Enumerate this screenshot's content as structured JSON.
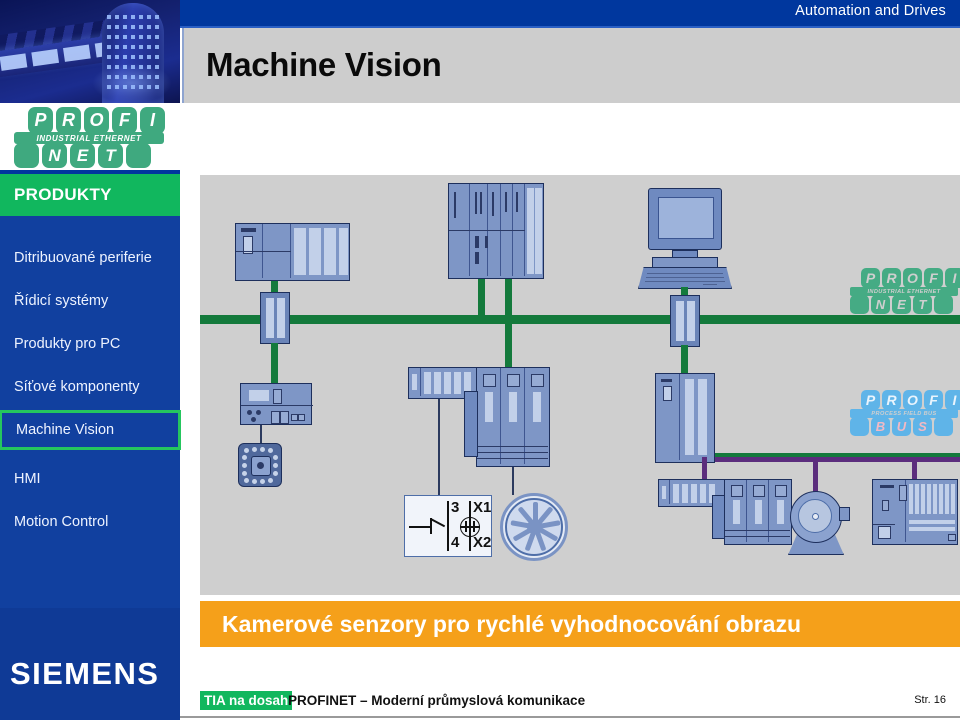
{
  "header": {
    "banner_text": "Automation and Drives",
    "title": "Machine Vision",
    "banner_color": "#00379e",
    "title_bg": "#cdcdcd"
  },
  "brand_logo": {
    "top_letters": [
      "P",
      "R",
      "O",
      "F",
      "I"
    ],
    "strip_text": "INDUSTRIAL ETHERNET",
    "bottom_letters": [
      "",
      "N",
      "E",
      "T",
      ""
    ],
    "color": "#3fa97f"
  },
  "sidebar": {
    "heading": "PRODUKTY",
    "heading_color": "#11b75e",
    "bg_color": "#11409f",
    "active_border": "#25c65e",
    "items": [
      {
        "label": "Ditribuované periferie",
        "active": false
      },
      {
        "label": "Řídicí systémy",
        "active": false
      },
      {
        "label": "Produkty pro PC",
        "active": false
      },
      {
        "label": "Síťové komponenty",
        "active": false
      },
      {
        "label": "Machine Vision",
        "active": true
      },
      {
        "label": "HMI",
        "active": false
      },
      {
        "label": "Motion Control",
        "active": false
      }
    ],
    "company": "SIEMENS"
  },
  "diagram": {
    "bg_color": "#cfcfcf",
    "profinet_bus_color": "#147a3c",
    "profibus_bus_color": "#5b2d7d",
    "profinet_logo": {
      "top_letters": [
        "P",
        "R",
        "O",
        "F",
        "I"
      ],
      "strip_text": "INDUSTRIAL ETHERNET",
      "bottom_letters": [
        "",
        "N",
        "E",
        "T",
        ""
      ]
    },
    "profibus_logo": {
      "top_letters": [
        "P",
        "R",
        "O",
        "F",
        "I"
      ],
      "strip_text": "PROCESS FIELD BUS",
      "bottom_letters": [
        "",
        "B",
        "U",
        "S",
        ""
      ]
    },
    "circuit_labels": {
      "contact_top": "3",
      "contact_bottom": "4",
      "terminal_top": "X1",
      "terminal_bottom": "X2"
    }
  },
  "caption": {
    "text": "Kamerové senzory pro rychlé vyhodnocování obrazu",
    "bg_color": "#f5a01a"
  },
  "footer": {
    "badge": "TIA na dosah",
    "text": "PROFINET – Moderní průmyslová komunikace",
    "page": "Str. 16"
  }
}
